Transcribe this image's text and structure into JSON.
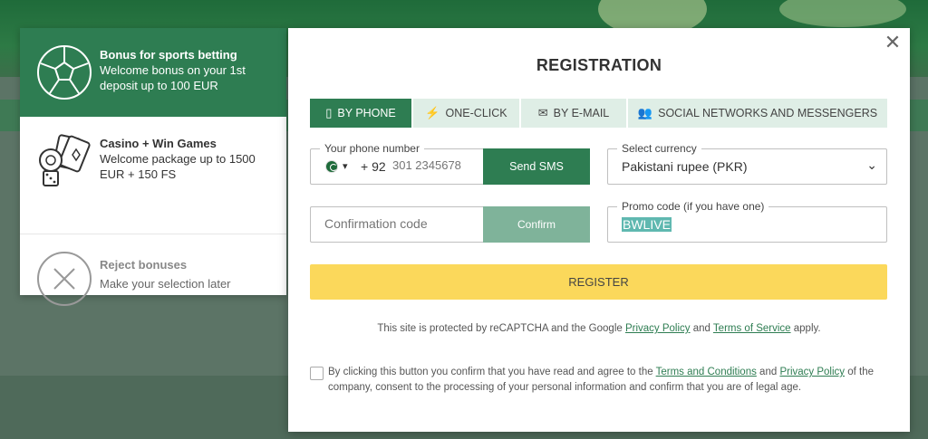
{
  "bonuses": [
    {
      "title": "Bonus for sports betting",
      "desc": "Welcome bonus on your 1st deposit up to 100 EUR",
      "icon": "soccer-ball-icon"
    },
    {
      "title": "Casino + Win Games",
      "desc": "Welcome package up to 1500 EUR + 150 FS",
      "icon": "casino-chips-icon"
    },
    {
      "title": "Reject bonuses",
      "desc": "Make your selection later",
      "icon": "reject-x-icon"
    }
  ],
  "modal": {
    "title": "REGISTRATION",
    "close": "✕",
    "tabs": [
      {
        "label": "BY PHONE",
        "icon": "phone-icon"
      },
      {
        "label": "ONE-CLICK",
        "icon": "lightning-icon"
      },
      {
        "label": "BY E-MAIL",
        "icon": "envelope-icon"
      },
      {
        "label": "SOCIAL NETWORKS AND MESSENGERS",
        "icon": "people-icon"
      }
    ],
    "phone": {
      "legend": "Your phone number",
      "prefix": "+ 92",
      "placeholder": "301 2345678",
      "send_label": "Send SMS"
    },
    "currency": {
      "legend": "Select currency",
      "value": "Pakistani rupee (PKR)"
    },
    "confirmation": {
      "placeholder": "Confirmation code",
      "button": "Confirm"
    },
    "promo": {
      "legend": "Promo code (if you have one)",
      "value": "BWLIVE"
    },
    "register_label": "REGISTER",
    "recaptcha": {
      "before": "This site is protected by reCAPTCHA and the Google ",
      "privacy": "Privacy Policy",
      "and": " and ",
      "terms": "Terms of Service",
      "after": " apply."
    },
    "consent": {
      "before": "By clicking this button you confirm that you have read and agree to the ",
      "terms": "Terms and Conditions",
      "and": " and ",
      "privacy": "Privacy Policy",
      "after": " of the company, consent to the processing of your personal information and confirm that you are of legal age."
    }
  },
  "colors": {
    "brand_green": "#2e7d52",
    "register_yellow": "#fbd85b",
    "tab_inactive": "#dfeee6"
  }
}
